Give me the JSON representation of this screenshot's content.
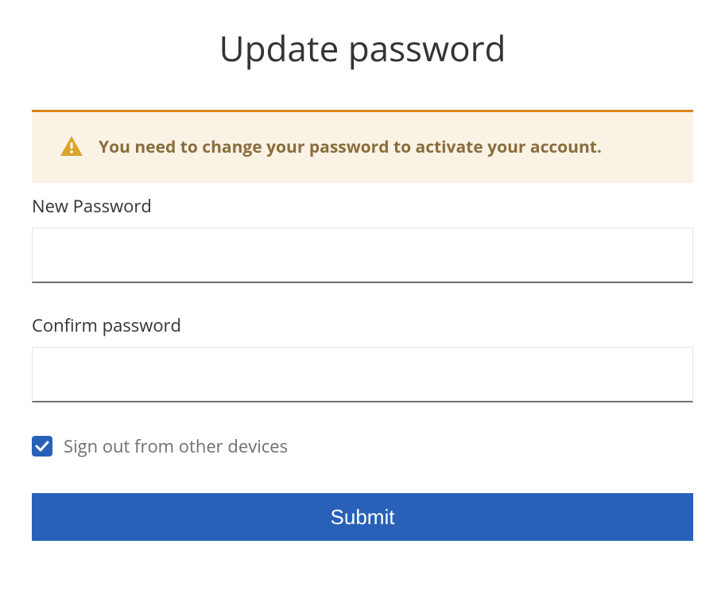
{
  "title": "Update password",
  "alert": {
    "icon": "warning-triangle-icon",
    "message": "You need to change your password to activate your account."
  },
  "fields": {
    "new_password": {
      "label": "New Password",
      "value": ""
    },
    "confirm_password": {
      "label": "Confirm password",
      "value": ""
    }
  },
  "signout": {
    "label": "Sign out from other devices",
    "checked": true
  },
  "submit_label": "Submit",
  "colors": {
    "accent": "#2861b7",
    "alert_bg": "#faf2e5",
    "alert_border": "#d9831f",
    "alert_text": "#8a6d3b",
    "alert_icon": "#d9a52b"
  }
}
